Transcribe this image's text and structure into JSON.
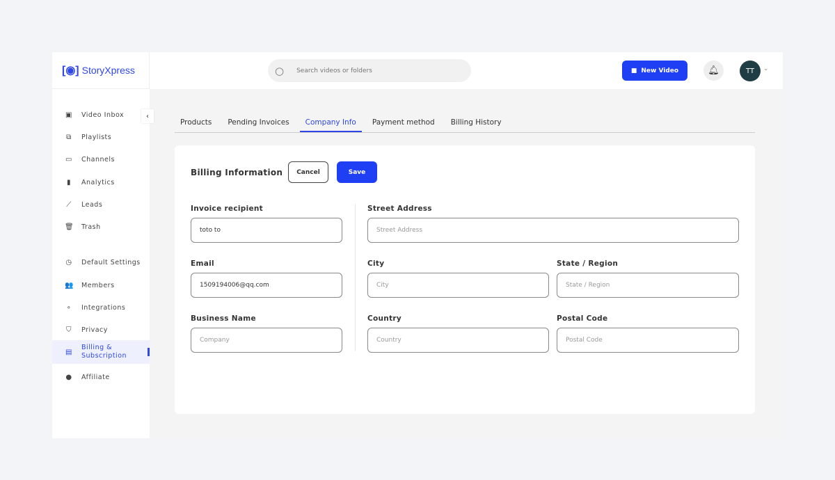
{
  "brand": {
    "name": "StoryXpress",
    "color": "#2e47e6"
  },
  "header": {
    "search_placeholder": "Search videos or folders",
    "new_video": "New Video",
    "avatar_initials": "TT"
  },
  "sidebar": {
    "items": [
      {
        "label": "Video Inbox",
        "icon": "inbox-icon",
        "glyph": "▣"
      },
      {
        "label": "Playlists",
        "icon": "playlist-icon",
        "glyph": "⧉"
      },
      {
        "label": "Channels",
        "icon": "channel-icon",
        "glyph": "▭"
      },
      {
        "label": "Analytics",
        "icon": "analytics-icon",
        "glyph": "▮"
      },
      {
        "label": "Leads",
        "icon": "leads-icon",
        "glyph": "⟋"
      },
      {
        "label": "Trash",
        "icon": "trash-icon",
        "glyph": "🗑"
      },
      {
        "label": "Default Settings",
        "icon": "settings-icon",
        "glyph": "◷"
      },
      {
        "label": "Members",
        "icon": "members-icon",
        "glyph": "👥"
      },
      {
        "label": "Integrations",
        "icon": "integrations-icon",
        "glyph": "∘"
      },
      {
        "label": "Privacy",
        "icon": "shield-icon",
        "glyph": "⛉"
      },
      {
        "label": "Billing & Subscription",
        "icon": "billing-icon",
        "glyph": "▤"
      },
      {
        "label": "Affiliate",
        "icon": "affiliate-icon",
        "glyph": "●"
      }
    ],
    "active": "Billing & Subscription"
  },
  "tabs": [
    {
      "label": "Products"
    },
    {
      "label": "Pending Invoices"
    },
    {
      "label": "Company Info",
      "active": true
    },
    {
      "label": "Payment method"
    },
    {
      "label": "Billing History"
    }
  ],
  "form": {
    "title": "Billing Information",
    "cancel": "Cancel",
    "save": "Save",
    "invoice_recipient": {
      "label": "Invoice recipient",
      "value": "toto to"
    },
    "email": {
      "label": "Email",
      "value": "1509194006@qq.com"
    },
    "business_name": {
      "label": "Business Name",
      "placeholder": "Company"
    },
    "street": {
      "label": "Street Address",
      "placeholder": "Street Address"
    },
    "city": {
      "label": "City",
      "placeholder": "City"
    },
    "state": {
      "label": "State / Region",
      "placeholder": "State / Region"
    },
    "country": {
      "label": "Country",
      "placeholder": "Country"
    },
    "postal": {
      "label": "Postal Code",
      "placeholder": "Postal Code"
    }
  }
}
